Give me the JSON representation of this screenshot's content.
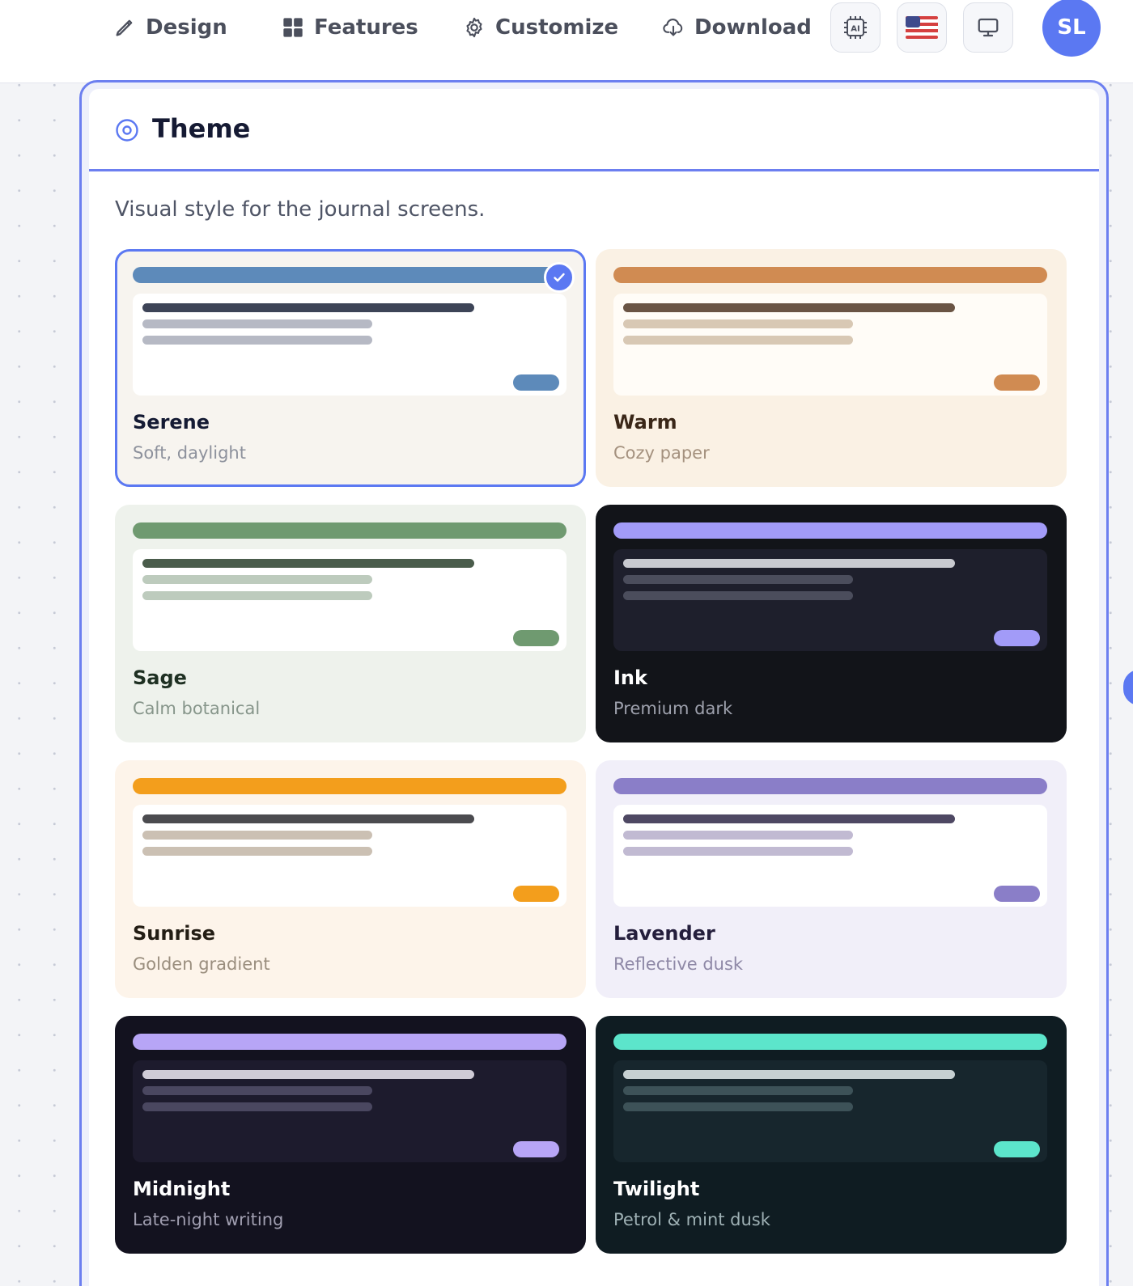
{
  "nav": {
    "items": [
      {
        "label": "Design",
        "icon": "pen-icon"
      },
      {
        "label": "Features",
        "icon": "grid-icon"
      },
      {
        "label": "Customize",
        "icon": "gear-icon"
      },
      {
        "label": "Download",
        "icon": "cloud-download-icon"
      }
    ],
    "ai_badge": "AI",
    "avatar_initials": "SL"
  },
  "panel": {
    "title": "Theme",
    "description": "Visual style for the journal screens."
  },
  "themes": [
    {
      "name": "Serene",
      "subtitle": "Soft, daylight",
      "selected": true,
      "colors": {
        "card": "#f7f4ef",
        "bar": "#5d8aba",
        "preview": "#ffffff",
        "line1": "#3d4457",
        "line2": "#b6b9c4",
        "pill": "#5d8aba",
        "name": "#141a33",
        "sub": "#8d919c"
      }
    },
    {
      "name": "Warm",
      "subtitle": "Cozy paper",
      "selected": false,
      "colors": {
        "card": "#faf1e4",
        "bar": "#d08b52",
        "preview": "#fffcf7",
        "line1": "#6a5444",
        "line2": "#d8c8b4",
        "pill": "#d08b52",
        "name": "#3a2718",
        "sub": "#a4917e"
      }
    },
    {
      "name": "Sage",
      "subtitle": "Calm botanical",
      "selected": false,
      "colors": {
        "card": "#eef2ec",
        "bar": "#6f9a70",
        "preview": "#ffffff",
        "line1": "#4a5c4b",
        "line2": "#bdcbbd",
        "pill": "#6f9a70",
        "name": "#1e3022",
        "sub": "#86958a"
      }
    },
    {
      "name": "Ink",
      "subtitle": "Premium dark",
      "selected": false,
      "colors": {
        "card": "#121419",
        "bar": "#a29bf8",
        "preview": "#1e1f2c",
        "line1": "#c8c9cf",
        "line2": "#4b4d5c",
        "pill": "#a29bf8",
        "name": "#ffffff",
        "sub": "#9ea1ad"
      }
    },
    {
      "name": "Sunrise",
      "subtitle": "Golden gradient",
      "selected": false,
      "colors": {
        "card": "#fdf4ea",
        "bar": "#f39e1c",
        "preview": "#ffffff",
        "line1": "#4b4b4f",
        "line2": "#cbc0b3",
        "pill": "#f39e1c",
        "name": "#231d14",
        "sub": "#9a8e7e"
      }
    },
    {
      "name": "Lavender",
      "subtitle": "Reflective dusk",
      "selected": false,
      "colors": {
        "card": "#f1eff9",
        "bar": "#8a7ec8",
        "preview": "#ffffff",
        "line1": "#4e4863",
        "line2": "#c1bad2",
        "pill": "#8a7ec8",
        "name": "#241e3c",
        "sub": "#8e88a6"
      }
    },
    {
      "name": "Midnight",
      "subtitle": "Late-night writing",
      "selected": false,
      "colors": {
        "card": "#13121f",
        "bar": "#b7a5f6",
        "preview": "#1d1b2d",
        "line1": "#cfcbd6",
        "line2": "#4a4760",
        "pill": "#b7a5f6",
        "name": "#ffffff",
        "sub": "#a09eb0"
      }
    },
    {
      "name": "Twilight",
      "subtitle": "Petrol & mint dusk",
      "selected": false,
      "colors": {
        "card": "#0f1c22",
        "bar": "#5ce5cb",
        "preview": "#17262d",
        "line1": "#c6d0d2",
        "line2": "#3d5258",
        "pill": "#5ce5cb",
        "name": "#ffffff",
        "sub": "#9eb0b4"
      }
    }
  ]
}
